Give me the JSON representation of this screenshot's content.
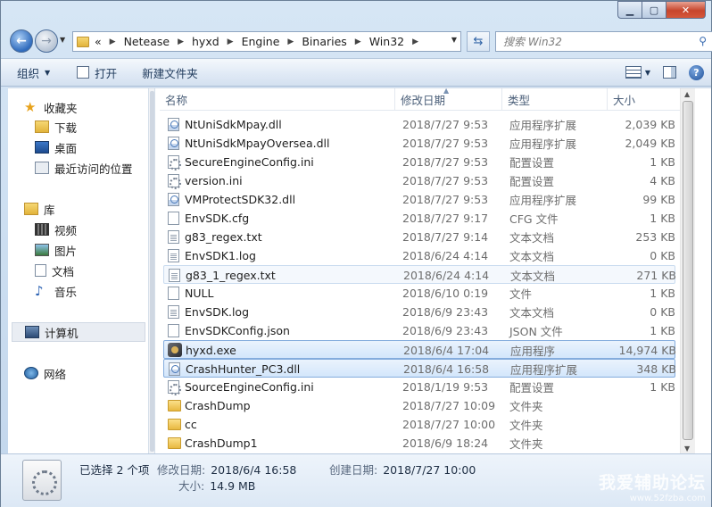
{
  "address": {
    "overflow": "«",
    "crumbs": [
      "Netease",
      "hyxd",
      "Engine",
      "Binaries",
      "Win32"
    ]
  },
  "search": {
    "placeholder": "搜索 Win32"
  },
  "toolbar": {
    "organize": "组织",
    "open": "打开",
    "new_folder": "新建文件夹"
  },
  "nav": {
    "favorites": "收藏夹",
    "downloads": "下载",
    "desktop": "桌面",
    "recent": "最近访问的位置",
    "libraries": "库",
    "videos": "视频",
    "pictures": "图片",
    "documents": "文档",
    "music": "音乐",
    "computer": "计算机",
    "network": "网络"
  },
  "columns": {
    "name": "名称",
    "date": "修改日期",
    "type": "类型",
    "size": "大小"
  },
  "files": [
    {
      "name": "NtUniSdkMpay.dll",
      "date": "2018/7/27 9:53",
      "type": "应用程序扩展",
      "size": "2,039 KB",
      "icon": "dll-icon"
    },
    {
      "name": "NtUniSdkMpayOversea.dll",
      "date": "2018/7/27 9:53",
      "type": "应用程序扩展",
      "size": "2,049 KB",
      "icon": "dll-icon"
    },
    {
      "name": "SecureEngineConfig.ini",
      "date": "2018/7/27 9:53",
      "type": "配置设置",
      "size": "1 KB",
      "icon": "ini-icon"
    },
    {
      "name": "version.ini",
      "date": "2018/7/27 9:53",
      "type": "配置设置",
      "size": "4 KB",
      "icon": "ini-icon"
    },
    {
      "name": "VMProtectSDK32.dll",
      "date": "2018/7/27 9:53",
      "type": "应用程序扩展",
      "size": "99 KB",
      "icon": "dll-icon"
    },
    {
      "name": "EnvSDK.cfg",
      "date": "2018/7/27 9:17",
      "type": "CFG 文件",
      "size": "1 KB",
      "icon": "file-icon"
    },
    {
      "name": "g83_regex.txt",
      "date": "2018/7/27 9:14",
      "type": "文本文档",
      "size": "253 KB",
      "icon": "txt-icon"
    },
    {
      "name": "EnvSDK1.log",
      "date": "2018/6/24 4:14",
      "type": "文本文档",
      "size": "0 KB",
      "icon": "txt-icon"
    },
    {
      "name": "g83_1_regex.txt",
      "date": "2018/6/24 4:14",
      "type": "文本文档",
      "size": "271 KB",
      "icon": "txt-icon"
    },
    {
      "name": "NULL",
      "date": "2018/6/10 0:19",
      "type": "文件",
      "size": "1 KB",
      "icon": "file-icon"
    },
    {
      "name": "EnvSDK.log",
      "date": "2018/6/9 23:43",
      "type": "文本文档",
      "size": "0 KB",
      "icon": "txt-icon"
    },
    {
      "name": "EnvSDKConfig.json",
      "date": "2018/6/9 23:43",
      "type": "JSON 文件",
      "size": "1 KB",
      "icon": "file-icon"
    },
    {
      "name": "hyxd.exe",
      "date": "2018/6/4 17:04",
      "type": "应用程序",
      "size": "14,974 KB",
      "icon": "exe-icon"
    },
    {
      "name": "CrashHunter_PC3.dll",
      "date": "2018/6/4 16:58",
      "type": "应用程序扩展",
      "size": "348 KB",
      "icon": "dll-icon"
    },
    {
      "name": "SourceEngineConfig.ini",
      "date": "2018/1/19 9:53",
      "type": "配置设置",
      "size": "1 KB",
      "icon": "ini-icon"
    },
    {
      "name": "CrashDump",
      "date": "2018/7/27 10:09",
      "type": "文件夹",
      "size": "",
      "icon": "folder-icon"
    },
    {
      "name": "cc",
      "date": "2018/7/27 10:00",
      "type": "文件夹",
      "size": "",
      "icon": "folder-icon"
    },
    {
      "name": "CrashDump1",
      "date": "2018/6/9 18:24",
      "type": "文件夹",
      "size": "",
      "icon": "folder-icon"
    }
  ],
  "details": {
    "selected": "已选择 2 个项",
    "modified_label": "修改日期:",
    "modified": "2018/6/4 16:58",
    "created_label": "创建日期:",
    "created": "2018/7/27 10:00",
    "size_label": "大小:",
    "size": "14.9 MB"
  },
  "watermark": {
    "line1": "我爱辅助论坛",
    "line2": "www.52fzba.com"
  }
}
